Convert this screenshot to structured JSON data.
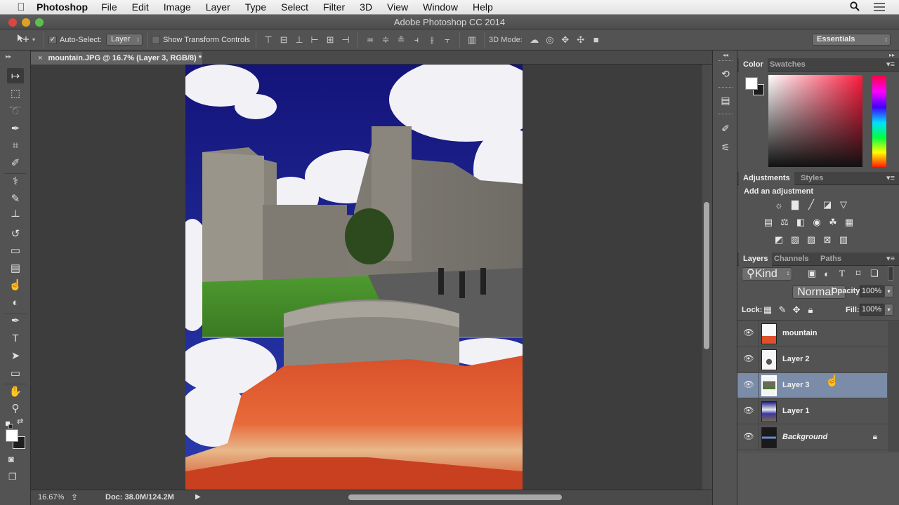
{
  "menubar": {
    "apple": "",
    "app_name": "Photoshop",
    "items": [
      "File",
      "Edit",
      "Image",
      "Layer",
      "Type",
      "Select",
      "Filter",
      "3D",
      "View",
      "Window",
      "Help"
    ],
    "search_icon": "search-icon",
    "list_icon": "list-icon"
  },
  "window": {
    "title": "Adobe Photoshop CC 2014",
    "traffic_lights": {
      "close": "#e0443e",
      "minimize": "#dea123",
      "zoom": "#5fbf4e"
    }
  },
  "options_bar": {
    "tool_preset": "move-tool",
    "auto_select_label": "Auto-Select:",
    "auto_select_checked": true,
    "auto_select_target": "Layer",
    "show_transform_label": "Show Transform Controls",
    "show_transform_checked": false,
    "align_icons": [
      "align-top-edges",
      "align-vertical-centers",
      "align-bottom-edges",
      "align-left-edges",
      "align-horizontal-centers",
      "align-right-edges"
    ],
    "distribute_icons": [
      "distribute-top-edges",
      "distribute-vertical-centers",
      "distribute-bottom-edges",
      "distribute-left-edges",
      "distribute-horizontal-centers",
      "distribute-right-edges"
    ],
    "auto_align_icon": "auto-align-layers",
    "mode_3d_label": "3D Mode:",
    "mode_3d_icons": [
      "rotate-3d",
      "roll-3d",
      "drag-3d",
      "slide-3d",
      "scale-3d"
    ],
    "workspace": "Essentials"
  },
  "document": {
    "tab_title": "mountain.JPG @ 16.7% (Layer 3, RGB/8) *",
    "zoom": "16.67%",
    "doc_size": "Doc: 38.0M/124.2M"
  },
  "tools": [
    {
      "name": "move-tool",
      "glyph": "↦",
      "active": true
    },
    {
      "name": "rectangular-marquee-tool",
      "glyph": "⬚"
    },
    {
      "name": "lasso-tool",
      "glyph": "➰"
    },
    {
      "name": "quick-selection-tool",
      "glyph": "✒"
    },
    {
      "name": "crop-tool",
      "glyph": "⌗"
    },
    {
      "name": "eyedropper-tool",
      "glyph": "✐"
    },
    {
      "name": "spot-healing-brush-tool",
      "glyph": "⚕"
    },
    {
      "name": "brush-tool",
      "glyph": "✎"
    },
    {
      "name": "clone-stamp-tool",
      "glyph": "┴"
    },
    {
      "name": "history-brush-tool",
      "glyph": "↺"
    },
    {
      "name": "eraser-tool",
      "glyph": "▭"
    },
    {
      "name": "gradient-tool",
      "glyph": "▤"
    },
    {
      "name": "blur-tool",
      "glyph": "☝"
    },
    {
      "name": "dodge-tool",
      "glyph": "◐"
    },
    {
      "name": "pen-tool",
      "glyph": "✒"
    },
    {
      "name": "type-tool",
      "glyph": "T"
    },
    {
      "name": "path-selection-tool",
      "glyph": "➤"
    },
    {
      "name": "rectangle-tool",
      "glyph": "▭"
    },
    {
      "name": "hand-tool",
      "glyph": "✋"
    },
    {
      "name": "zoom-tool",
      "glyph": "⚲"
    }
  ],
  "colors": {
    "foreground": "#ffffff",
    "background": "#1e1e1e"
  },
  "dock_icons": [
    "history-icon",
    "properties-icon",
    "brush-presets-icon",
    "brush-icon"
  ],
  "color_panel": {
    "tabs": [
      "Color",
      "Swatches"
    ],
    "active_tab": "Color",
    "hue_color": "#ff1a3c"
  },
  "adjustments_panel": {
    "tabs": [
      "Adjustments",
      "Styles"
    ],
    "active_tab": "Adjustments",
    "heading": "Add an adjustment",
    "rows": [
      [
        {
          "name": "brightness-contrast",
          "glyph": "☼"
        },
        {
          "name": "levels",
          "glyph": "▇"
        },
        {
          "name": "curves",
          "glyph": "╱"
        },
        {
          "name": "exposure",
          "glyph": "◪"
        },
        {
          "name": "vibrance",
          "glyph": "▽"
        }
      ],
      [
        {
          "name": "hue-saturation",
          "glyph": "▤"
        },
        {
          "name": "color-balance",
          "glyph": "⚖"
        },
        {
          "name": "black-white",
          "glyph": "◧"
        },
        {
          "name": "photo-filter",
          "glyph": "◉"
        },
        {
          "name": "channel-mixer",
          "glyph": "☘"
        },
        {
          "name": "color-lookup",
          "glyph": "▦"
        }
      ],
      [
        {
          "name": "invert",
          "glyph": "◩"
        },
        {
          "name": "posterize",
          "glyph": "▧"
        },
        {
          "name": "threshold",
          "glyph": "▨"
        },
        {
          "name": "selective-color",
          "glyph": "⊠"
        },
        {
          "name": "gradient-map",
          "glyph": "▥"
        }
      ]
    ]
  },
  "layers_panel": {
    "tabs": [
      "Layers",
      "Channels",
      "Paths"
    ],
    "active_tab": "Layers",
    "filter_kind": "Kind",
    "filter_icons": [
      "pixel-filter-icon",
      "adjustment-filter-icon",
      "type-filter-icon",
      "shape-filter-icon",
      "smart-object-filter-icon"
    ],
    "blend_mode": "Normal",
    "opacity_label": "Opacity:",
    "opacity": "100%",
    "lock_label": "Lock:",
    "lock_icons": [
      "lock-transparent-icon",
      "lock-paint-icon",
      "lock-position-icon",
      "lock-all-icon"
    ],
    "fill_label": "Fill:",
    "fill": "100%",
    "layers": [
      {
        "name": "mountain",
        "visible": true,
        "selected": false,
        "italic": false,
        "locked": false,
        "thumb": "mountain"
      },
      {
        "name": "Layer 2",
        "visible": true,
        "selected": false,
        "italic": false,
        "locked": false,
        "thumb": "tower"
      },
      {
        "name": "Layer 3",
        "visible": true,
        "selected": true,
        "italic": false,
        "locked": false,
        "thumb": "castle"
      },
      {
        "name": "Layer 1",
        "visible": true,
        "selected": false,
        "italic": false,
        "locked": false,
        "thumb": "clouds"
      },
      {
        "name": "Background",
        "visible": true,
        "selected": false,
        "italic": true,
        "locked": true,
        "thumb": "background"
      }
    ]
  }
}
